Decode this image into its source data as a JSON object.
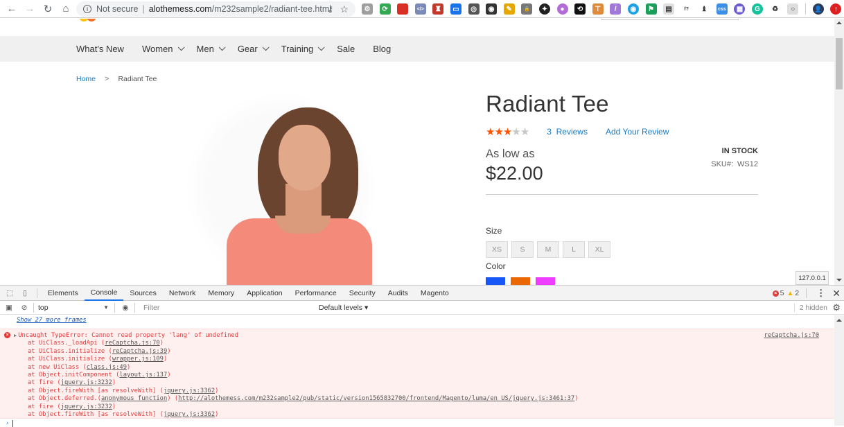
{
  "browser": {
    "security_label": "Not secure",
    "url_host": "alothemess.com",
    "url_path": "/m232sample2/radiant-tee.html",
    "extensions": [
      {
        "name": "gear-extension",
        "color": "#9e9e9e",
        "glyph": "⚙"
      },
      {
        "name": "refresh-extension",
        "color": "#34a853",
        "glyph": "⟳"
      },
      {
        "name": "book-extension",
        "color": "#d93025",
        "glyph": ""
      },
      {
        "name": "code-extension",
        "color": "#7b8ab8",
        "glyph": "</>"
      },
      {
        "name": "badge-extension",
        "color": "#c0392b",
        "glyph": "♜"
      },
      {
        "name": "screen-extension",
        "color": "#1a73e8",
        "glyph": "▭"
      },
      {
        "name": "sync-extension",
        "color": "#555555",
        "glyph": "◎"
      },
      {
        "name": "record-extension",
        "color": "#333333",
        "glyph": "◉"
      },
      {
        "name": "palette-extension",
        "color": "#e6a700",
        "glyph": "✎"
      },
      {
        "name": "lock-extension",
        "color": "#777777",
        "glyph": "🔒"
      },
      {
        "name": "puzzle-extension",
        "color": "#222222",
        "glyph": "✦"
      },
      {
        "name": "purple-extension",
        "color": "#b36bd8",
        "glyph": "●"
      },
      {
        "name": "cycle-extension",
        "color": "#111111",
        "glyph": "⟲"
      },
      {
        "name": "sign-extension",
        "color": "#e08a3b",
        "glyph": "⊤"
      },
      {
        "name": "pen-extension",
        "color": "#a279d8",
        "glyph": "/"
      },
      {
        "name": "eye-extension",
        "color": "#1aa1e8",
        "glyph": "◉"
      },
      {
        "name": "flag-extension",
        "color": "#1b9e5a",
        "glyph": "⚑"
      },
      {
        "name": "calendar-extension",
        "color": "#e0e0e0",
        "glyph": "▤"
      },
      {
        "name": "font-extension",
        "color": "#ffffff",
        "glyph": "f?"
      },
      {
        "name": "chess-extension",
        "color": "#ffffff",
        "glyph": "♝"
      },
      {
        "name": "css-extension",
        "color": "#3d8fe6",
        "glyph": "css"
      },
      {
        "name": "grid-extension",
        "color": "#6a5acd",
        "glyph": "▦"
      },
      {
        "name": "grammarly-extension",
        "color": "#15c39a",
        "glyph": "G"
      },
      {
        "name": "recycle-extension",
        "color": "#ffffff",
        "glyph": "♻"
      },
      {
        "name": "cloud-extension",
        "color": "#dddddd",
        "glyph": "○"
      }
    ]
  },
  "site": {
    "nav": [
      {
        "label": "What's New",
        "has_dropdown": false
      },
      {
        "label": "Women",
        "has_dropdown": true
      },
      {
        "label": "Men",
        "has_dropdown": true
      },
      {
        "label": "Gear",
        "has_dropdown": true
      },
      {
        "label": "Training",
        "has_dropdown": true
      },
      {
        "label": "Sale",
        "has_dropdown": false
      },
      {
        "label": "Blog",
        "has_dropdown": false
      }
    ],
    "breadcrumb": {
      "home": "Home",
      "separator": ">",
      "current": "Radiant Tee"
    },
    "product": {
      "title": "Radiant Tee",
      "rating": {
        "stars": 3,
        "max": 5,
        "color_on": "#ff5501",
        "color_off": "#c7c7c7"
      },
      "reviews_count": "3",
      "reviews_label": "Reviews",
      "add_review": "Add Your Review",
      "price_prefix": "As low as",
      "price": "$22.00",
      "stock": "IN STOCK",
      "sku_label": "SKU#:",
      "sku": "WS12",
      "size_label": "Size",
      "sizes": [
        "XS",
        "S",
        "M",
        "L",
        "XL"
      ],
      "color_label": "Color",
      "colors": [
        "#1857f7",
        "#eb6703",
        "#ef3dff"
      ]
    },
    "status_bubble": "127.0.0.1"
  },
  "devtools": {
    "tabs": [
      "Elements",
      "Console",
      "Sources",
      "Network",
      "Memory",
      "Application",
      "Performance",
      "Security",
      "Audits",
      "Magento"
    ],
    "active_tab": "Console",
    "error_count": "5",
    "warning_count": "2",
    "context": "top",
    "filter_placeholder": "Filter",
    "levels": "Default levels ▾",
    "hidden": "2 hidden",
    "show_frames": "Show 27 more frames",
    "error": {
      "message": "Uncaught TypeError: Cannot read property 'lang' of undefined",
      "source": "reCaptcha.js:70",
      "stack": [
        {
          "pre": "at UiClass._loadApi (",
          "link": "reCaptcha.js:70",
          "post": ")"
        },
        {
          "pre": "at UiClass.initialize (",
          "link": "reCaptcha.js:39",
          "post": ")"
        },
        {
          "pre": "at UiClass.initialize (",
          "link": "wrapper.js:109",
          "post": ")"
        },
        {
          "pre": "at new UiClass (",
          "link": "class.js:49",
          "post": ")"
        },
        {
          "pre": "at Object.initComponent (",
          "link": "layout.js:137",
          "post": ")"
        },
        {
          "pre": "at fire (",
          "link": "jquery.js:3232",
          "post": ")"
        },
        {
          "pre": "at Object.fireWith [as resolveWith] (",
          "link": "jquery.js:3362",
          "post": ")"
        },
        {
          "pre": "at Object.deferred.(",
          "link": "anonymous function",
          "post": ") (",
          "link2": "http://alothemess.com/m232sample2/pub/static/version1565832700/frontend/Magento/luma/en_US/jquery.js:3461:37",
          "post2": ")"
        },
        {
          "pre": "at fire (",
          "link": "jquery.js:3232",
          "post": ")"
        },
        {
          "pre": "at Object.fireWith [as resolveWith] (",
          "link": "jquery.js:3362",
          "post": ")"
        }
      ]
    }
  }
}
